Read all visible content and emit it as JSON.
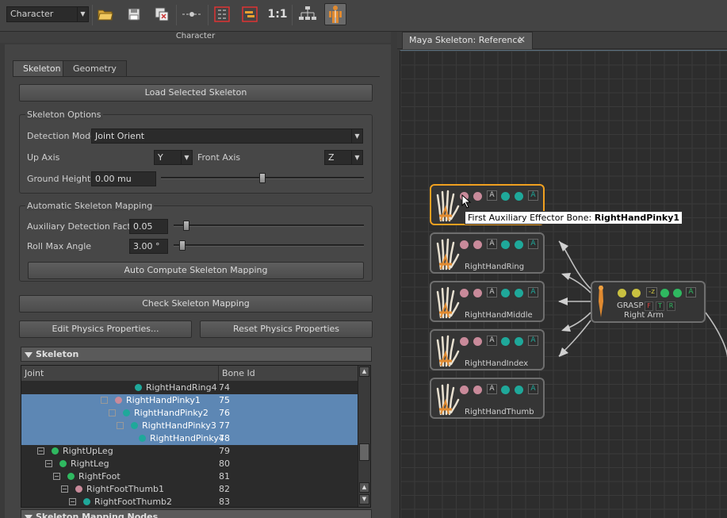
{
  "toolbar": {
    "character_select": "Character",
    "zoom_label": "1:1"
  },
  "panel_title": "Character",
  "tabs": [
    "Skeleton",
    "Geometry"
  ],
  "load_button": "Load Selected Skeleton",
  "skeleton_options": {
    "title": "Skeleton Options",
    "detection_mode_label": "Detection Mode",
    "detection_mode_value": "Joint Orient",
    "up_axis_label": "Up Axis",
    "up_axis_value": "Y",
    "front_axis_label": "Front Axis",
    "front_axis_value": "Z",
    "ground_height_label": "Ground Height",
    "ground_height_value": "0.00 mu",
    "ground_height_slider": 0.5
  },
  "auto_mapping": {
    "title": "Automatic Skeleton Mapping",
    "aux_label": "Auxiliary Detection Factor",
    "aux_value": "0.05",
    "aux_slider": 0.05,
    "roll_label": "Roll Max Angle",
    "roll_value": "3.00 °",
    "roll_slider": 0.03,
    "compute_button": "Auto Compute Skeleton Mapping"
  },
  "check_button": "Check Skeleton Mapping",
  "edit_physics_button": "Edit Physics Properties...",
  "reset_physics_button": "Reset Physics Properties",
  "skeleton_section": "Skeleton",
  "tree": {
    "col_joint": "Joint",
    "col_bone": "Bone Id",
    "rows": [
      {
        "name": "RightHandRing4",
        "id": "74",
        "color": "#1fa89a",
        "selected": false
      },
      {
        "name": "RightHandPinky1",
        "id": "75",
        "color": "#c98a9a",
        "selected": true
      },
      {
        "name": "RightHandPinky2",
        "id": "76",
        "color": "#1fa89a",
        "selected": true
      },
      {
        "name": "RightHandPinky3",
        "id": "77",
        "color": "#1fa89a",
        "selected": true
      },
      {
        "name": "RightHandPinky4",
        "id": "78",
        "color": "#1fa89a",
        "selected": true
      },
      {
        "name": "RightUpLeg",
        "id": "79",
        "color": "#2fb860",
        "selected": false
      },
      {
        "name": "RightLeg",
        "id": "80",
        "color": "#2fb860",
        "selected": false
      },
      {
        "name": "RightFoot",
        "id": "81",
        "color": "#2fb860",
        "selected": false
      },
      {
        "name": "RightFootThumb1",
        "id": "82",
        "color": "#c98a9a",
        "selected": false
      },
      {
        "name": "RightFootThumb2",
        "id": "83",
        "color": "#1fa89a",
        "selected": false
      }
    ]
  },
  "mapping_section": "Skeleton Mapping Nodes",
  "view_tab": "Maya Skeleton: Reference",
  "graph": {
    "nodes": [
      {
        "label": "",
        "active": true
      },
      {
        "label": "RightHandRing",
        "active": false
      },
      {
        "label": "RightHandMiddle",
        "active": false
      },
      {
        "label": "RightHandIndex",
        "active": false
      },
      {
        "label": "RightHandThumb",
        "active": false
      }
    ],
    "tooltip_prefix": "First Auxiliary Effector Bone:",
    "tooltip_bone": "RightHandPinky1",
    "arm": {
      "label": "Right Arm",
      "grasp": "GRASP",
      "f": "F",
      "t": "T",
      "r": "R",
      "z": "-z"
    },
    "badge": "A"
  },
  "colors": {
    "selection": "#5d87b4",
    "pink": "#c98a9a",
    "teal": "#1fa89a",
    "green": "#2fb860",
    "yellow": "#c8c040",
    "active_border": "#f0a020"
  }
}
